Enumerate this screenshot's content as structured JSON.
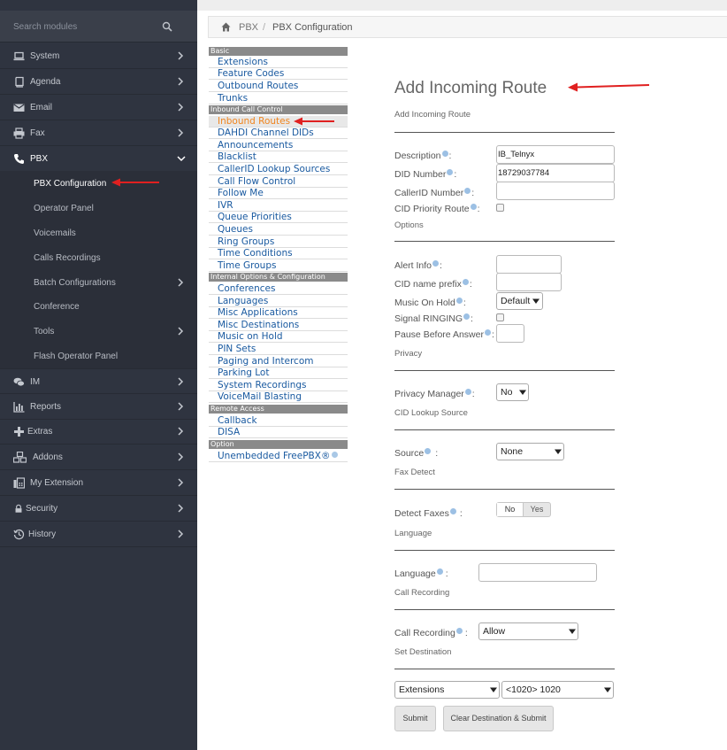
{
  "sidebar": {
    "search_placeholder": "Search modules",
    "items": [
      {
        "label": "System",
        "icon": "laptop-icon"
      },
      {
        "label": "Agenda",
        "icon": "book-icon"
      },
      {
        "label": "Email",
        "icon": "envelope-icon"
      },
      {
        "label": "Fax",
        "icon": "printer-icon"
      },
      {
        "label": "PBX",
        "icon": "phone-icon"
      },
      {
        "label": "IM",
        "icon": "chat-icon"
      },
      {
        "label": "Reports",
        "icon": "bar-chart-icon"
      },
      {
        "label": "Extras",
        "icon": "plus-icon"
      },
      {
        "label": "Addons",
        "icon": "cubes-icon"
      },
      {
        "label": "My Extension",
        "icon": "fax-icon"
      },
      {
        "label": "Security",
        "icon": "lock-icon"
      },
      {
        "label": "History",
        "icon": "history-icon"
      }
    ],
    "pbx_sub": [
      "PBX Configuration",
      "Operator Panel",
      "Voicemails",
      "Calls Recordings",
      "Batch Configurations",
      "Conference",
      "Tools",
      "Flash Operator Panel"
    ]
  },
  "breadcrumb": {
    "b1": "PBX",
    "sep": "/",
    "b2": "PBX Configuration"
  },
  "modmenu": {
    "basic": "Basic",
    "basic_items": [
      "Extensions",
      "Feature Codes",
      "Outbound Routes",
      "Trunks"
    ],
    "inbound": "Inbound Call Control",
    "inbound_items": [
      "Inbound Routes",
      "DAHDI Channel DIDs",
      "Announcements",
      "Blacklist",
      "CallerID Lookup Sources",
      "Call Flow Control",
      "Follow Me",
      "IVR",
      "Queue Priorities",
      "Queues",
      "Ring Groups",
      "Time Conditions",
      "Time Groups"
    ],
    "internal": "Internal Options & Configuration",
    "internal_items": [
      "Conferences",
      "Languages",
      "Misc Applications",
      "Misc Destinations",
      "Music on Hold",
      "PIN Sets",
      "Paging and Intercom",
      "Parking Lot",
      "System Recordings",
      "VoiceMail Blasting"
    ],
    "remote": "Remote Access",
    "remote_items": [
      "Callback",
      "DISA"
    ],
    "option": "Option",
    "option_items": [
      "Unembedded FreePBX®"
    ]
  },
  "form": {
    "title": "Add Incoming Route",
    "subtitle": "Add Incoming Route",
    "description_label": "Description",
    "description_value": "IB_Telnyx",
    "did_label": "DID Number",
    "did_value": "18729037784",
    "callerid_label": "CallerID Number",
    "callerid_value": "",
    "cid_priority_label": "CID Priority Route",
    "options_heading": "Options",
    "alert_info_label": "Alert Info",
    "cid_prefix_label": "CID name prefix",
    "moh_label": "Music On Hold",
    "moh_value": "Default",
    "signal_ringing_label": "Signal RINGING",
    "pause_label": "Pause Before Answer",
    "privacy_heading": "Privacy",
    "privacy_manager_label": "Privacy Manager",
    "privacy_manager_value": "No",
    "cid_lookup_heading": "CID Lookup Source",
    "source_label": "Source",
    "source_value": "None",
    "fax_heading": "Fax Detect",
    "detect_faxes_label": "Detect Faxes",
    "toggle_no": "No",
    "toggle_yes": "Yes",
    "language_heading": "Language",
    "language_label": "Language",
    "call_recording_heading": "Call Recording",
    "call_recording_label": "Call Recording",
    "call_recording_value": "Allow",
    "set_destination_heading": "Set Destination",
    "dest_type_value": "Extensions",
    "dest_value": "<1020> 1020",
    "colon": ":",
    "submit_label": "Submit",
    "clear_submit_label": "Clear Destination & Submit"
  },
  "colors": {
    "sidebar_bg": "#2f3440",
    "link": "#1a5aa0",
    "selected": "#f0851f",
    "annotation": "#e02020"
  }
}
